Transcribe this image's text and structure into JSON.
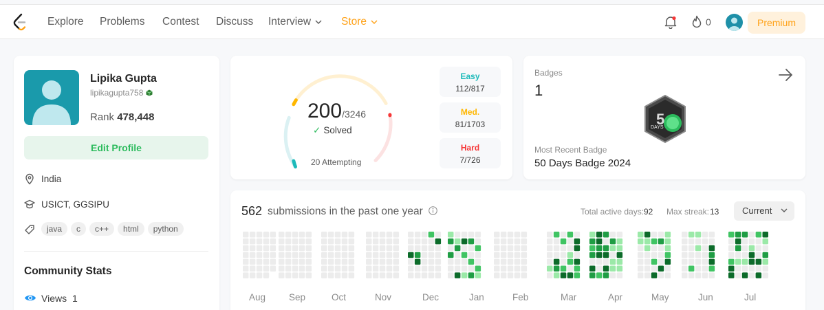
{
  "nav": {
    "links": [
      "Explore",
      "Problems",
      "Contest",
      "Discuss",
      "Interview",
      "Store"
    ],
    "fire_count": "0",
    "premium_label": "Premium"
  },
  "profile": {
    "name": "Lipika Gupta",
    "username": "lipikagupta758",
    "rank_label": "Rank",
    "rank_value": "478,448",
    "edit_label": "Edit Profile",
    "location": "India",
    "school": "USICT, GGSIPU",
    "skills": [
      "java",
      "c",
      "c++",
      "html",
      "python"
    ],
    "community_title": "Community Stats",
    "views_label": "Views",
    "views_value": "1"
  },
  "solved": {
    "count": "200",
    "total": "/3246",
    "solved_label": "Solved",
    "attempting": "20 Attempting",
    "difficulties": [
      {
        "name": "Easy",
        "value": "112/817",
        "color": "#1cbaba"
      },
      {
        "name": "Med.",
        "value": "81/1703",
        "color": "#ffb700"
      },
      {
        "name": "Hard",
        "value": "7/726",
        "color": "#f63737"
      }
    ]
  },
  "badges": {
    "title": "Badges",
    "count": "1",
    "recent_label": "Most Recent Badge",
    "recent_name": "50 Days Badge 2024",
    "badge_text": "DAYS"
  },
  "submissions": {
    "count": "562",
    "text": "submissions in the past one year",
    "active_days_label": "Total active days:",
    "active_days_value": "92",
    "max_streak_label": "Max streak:",
    "max_streak_value": "13",
    "period_select": "Current",
    "months": [
      "Aug",
      "Sep",
      "Oct",
      "Nov",
      "Dec",
      "Jan",
      "Feb",
      "Mar",
      "Apr",
      "May",
      "Jun",
      "Jul"
    ]
  },
  "colors": {
    "accent": "#ffa116",
    "green": "#2cbb5d",
    "heat_empty": "#ececec",
    "heat_levels": [
      "#9be9a8",
      "#40c463",
      "#1f9d44",
      "#0c6b2a"
    ]
  }
}
